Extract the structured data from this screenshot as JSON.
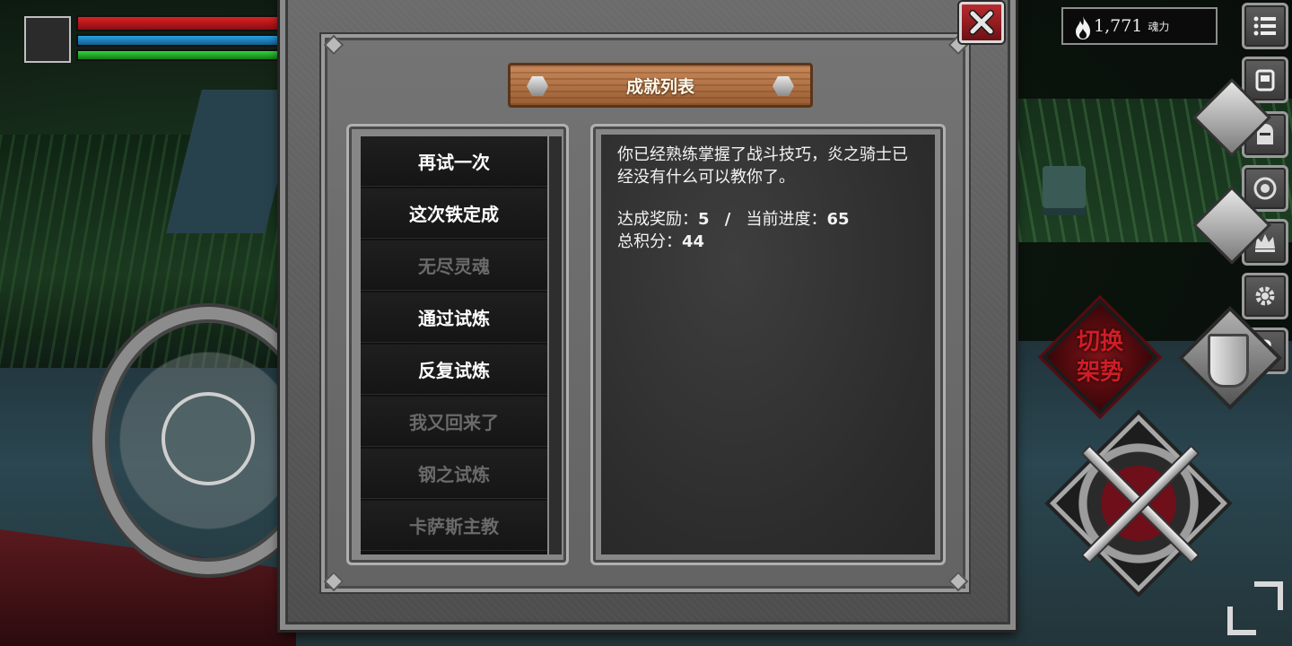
{
  "hud": {
    "currency_amount": "1,771",
    "currency_unit": "魂力",
    "hp_fraction": 1.0,
    "mp_fraction": 1.0,
    "stamina_fraction": 1.0
  },
  "panel": {
    "title": "成就列表",
    "close_icon": "close-x-icon"
  },
  "achievements": [
    {
      "label": "再试一次",
      "unlocked": true
    },
    {
      "label": "这次铁定成",
      "unlocked": true
    },
    {
      "label": "无尽灵魂",
      "unlocked": false
    },
    {
      "label": "通过试炼",
      "unlocked": true
    },
    {
      "label": "反复试炼",
      "unlocked": true
    },
    {
      "label": "我又回来了",
      "unlocked": false
    },
    {
      "label": "钢之试炼",
      "unlocked": false
    },
    {
      "label": "卡萨斯主教",
      "unlocked": false
    }
  ],
  "detail": {
    "description": "你已经熟练掌握了战斗技巧，炎之骑士已经没有什么可以教你了。",
    "reward_label": "达成奖励：",
    "reward_value": "5",
    "separator": "/",
    "progress_label": "当前进度：",
    "progress_value": "65",
    "total_label": "总积分：",
    "total_value": "44"
  },
  "skills": {
    "stance_label_line1": "切换",
    "stance_label_line2": "架势"
  },
  "side_menu": [
    {
      "name": "menu-list-icon"
    },
    {
      "name": "inventory-icon"
    },
    {
      "name": "helmet-icon"
    },
    {
      "name": "emblem-icon"
    },
    {
      "name": "crown-icon"
    },
    {
      "name": "gear-icon"
    },
    {
      "name": "help-icon",
      "glyph": "?"
    }
  ],
  "colors": {
    "hp": "#d22222",
    "mp": "#2aa0e0",
    "stamina": "#35d43b",
    "close_button": "#b62b2f",
    "stance_text": "#d01d25"
  }
}
